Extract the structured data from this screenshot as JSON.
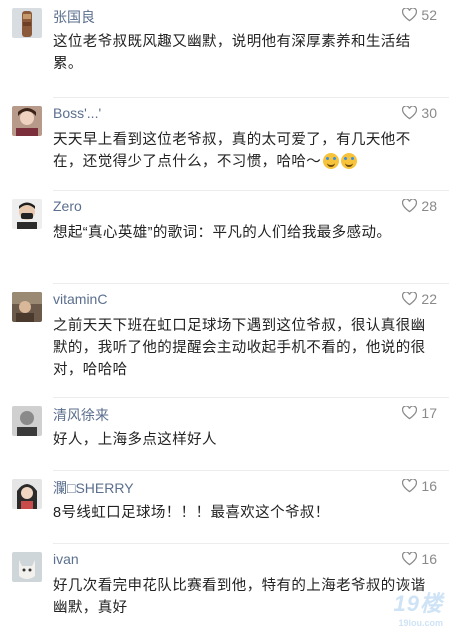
{
  "comments": [
    {
      "user": "张国良",
      "likes": "52",
      "text": "这位老爷叔既风趣又幽默，说明他有深厚素养和生活结累。",
      "avatar_icon": "totem-avatar-icon"
    },
    {
      "user": "Boss'...'",
      "likes": "30",
      "text": "天天早上看到这位老爷叔，真的太可爱了，有几天他不在，还觉得少了点什么，不习惯，哈哈～",
      "avatar_icon": "person-avatar-icon"
    },
    {
      "user": "Zero",
      "likes": "28",
      "text": "想起“真心英雄”的歌词：平凡的人们给我最多感动。",
      "avatar_icon": "masked-man-avatar-icon"
    },
    {
      "user": "vitaminC",
      "likes": "22",
      "text": "之前天天下班在虹口足球场下遇到这位爷叔，很认真很幽默的，我听了他的提醒会主动收起手机不看的，他说的很对，哈哈哈",
      "avatar_icon": "photo-avatar-icon"
    },
    {
      "user": "清风徐来",
      "likes": "17",
      "text": "好人，上海多点这样好人",
      "avatar_icon": "portrait-avatar-icon"
    },
    {
      "user": "瀾□SHERRY",
      "likes": "16",
      "text": "8号线虹口足球场！！！最喜欢这个爷叔！",
      "avatar_icon": "girl-avatar-icon"
    },
    {
      "user": "ivan",
      "likes": "16",
      "text": "好几次看完申花队比赛看到他，特有的上海老爷叔的诙谐幽默，真好",
      "avatar_icon": "cat-avatar-icon"
    }
  ],
  "watermark": {
    "brand": "19楼",
    "domain": "19lou.com"
  },
  "colors": {
    "username": "#5b6f8e",
    "likes": "#8a8a8a",
    "text": "#222222",
    "divider": "#ececec"
  }
}
